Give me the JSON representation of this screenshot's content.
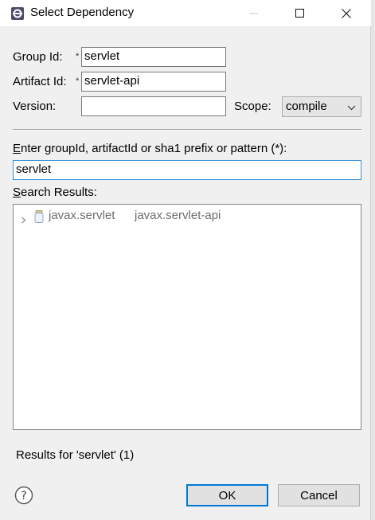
{
  "window": {
    "title": "Select Dependency"
  },
  "form": {
    "group_id_label": "Group Id:",
    "group_id_value": "servlet",
    "artifact_id_label": "Artifact Id:",
    "artifact_id_value": "servlet-api",
    "version_label": "Version:",
    "version_value": "",
    "required_marker": "*",
    "scope_label": "Scope:",
    "scope_value": "compile"
  },
  "search": {
    "query_label_first": "E",
    "query_label_rest": "nter groupId, artifactId or sha1 prefix or pattern (*):",
    "query_value": "servlet",
    "results_label_first": "S",
    "results_label_rest": "earch Results:"
  },
  "results": [
    {
      "group": "javax.servlet",
      "artifact": "javax.servlet-api"
    }
  ],
  "status": {
    "text": "Results for 'servlet' (1)"
  },
  "buttons": {
    "ok": "OK",
    "cancel": "Cancel"
  },
  "colors": {
    "focus_border": "#3c8fd6",
    "default_button_border": "#0078d7",
    "dimmed_result_text": "#6d6d6d"
  },
  "icons": {
    "app": "eclipse-icon",
    "minimize": "minimize-icon",
    "maximize": "maximize-icon",
    "close": "close-icon",
    "expand": "chevron-right-icon",
    "jar": "jar-icon",
    "help": "help-icon",
    "dropdown": "chevron-down-icon"
  }
}
